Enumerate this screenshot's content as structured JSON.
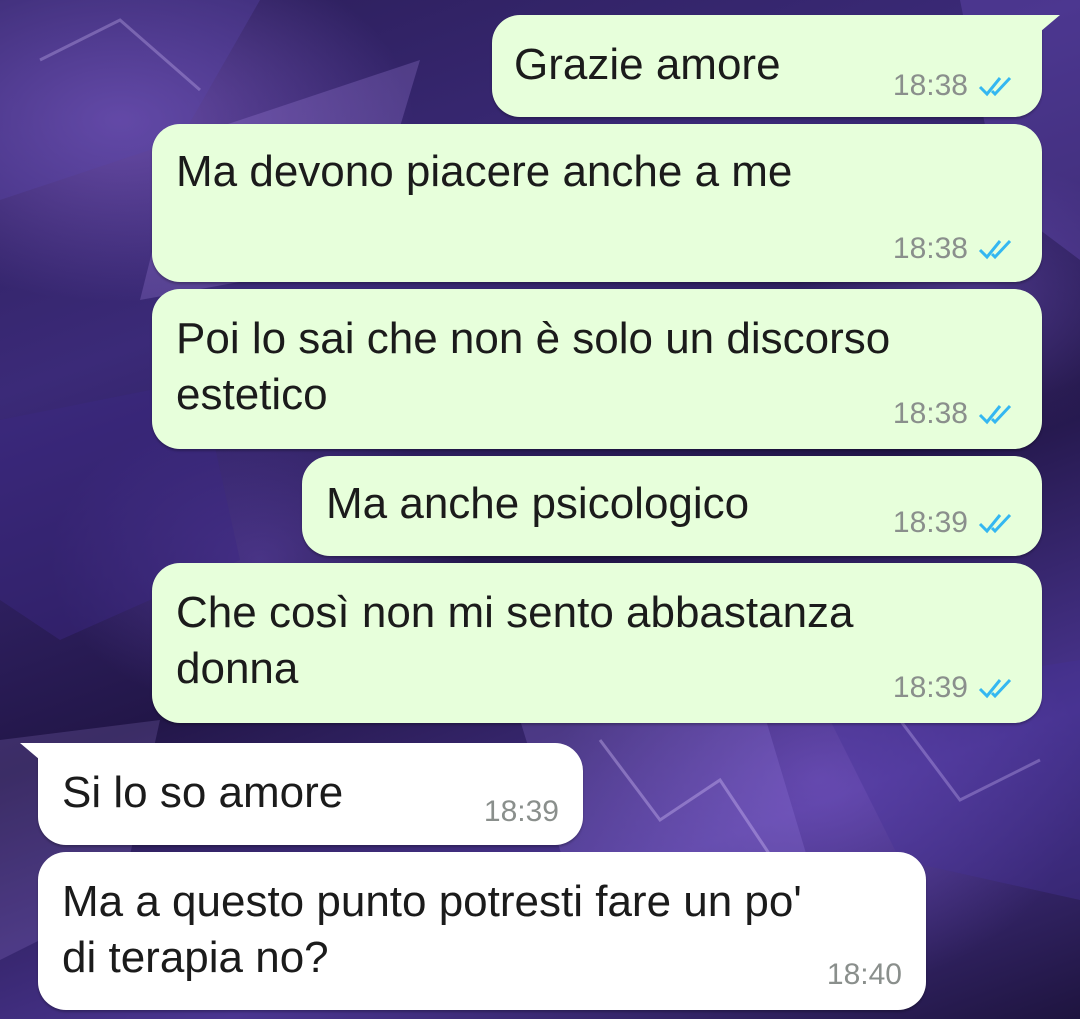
{
  "colors": {
    "outgoing_bubble": "#e7ffdb",
    "incoming_bubble": "#ffffff",
    "read_ticks": "#34b7f1",
    "timestamp": "#8a8f8c"
  },
  "messages": [
    {
      "direction": "outgoing",
      "text": "Grazie amore",
      "time": "18:38",
      "status": "read"
    },
    {
      "direction": "outgoing",
      "text": "Ma devono piacere anche a me",
      "time": "18:38",
      "status": "read"
    },
    {
      "direction": "outgoing",
      "text": "Poi lo sai che non è solo un discorso\nestetico",
      "time": "18:38",
      "status": "read"
    },
    {
      "direction": "outgoing",
      "text": "Ma anche psicologico",
      "time": "18:39",
      "status": "read"
    },
    {
      "direction": "outgoing",
      "text": "Che così non mi sento abbastanza\ndonna",
      "time": "18:39",
      "status": "read"
    },
    {
      "direction": "incoming",
      "text": "Si lo so amore",
      "time": "18:39"
    },
    {
      "direction": "incoming",
      "text": "Ma a questo punto potresti fare un po'\ndi terapia no?",
      "time": "18:40"
    }
  ]
}
